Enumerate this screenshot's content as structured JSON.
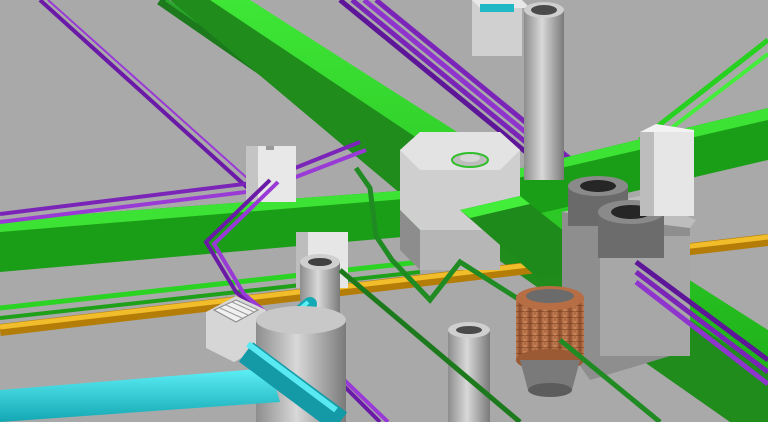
{
  "scene": {
    "kind": "3d-model-viewport",
    "colors": {
      "background": "#a9a9a9",
      "green_duct": "#22c71b",
      "green_duct_dark": "#1d7a1a",
      "dark_green_pipe": "#1f8b22",
      "purple_conduit": "#7a24b8",
      "yellow_pipe": "#e0a414",
      "cyan_pipe": "#1fc9d6",
      "equipment_light": "#d9d9d9",
      "equipment_mid": "#a6a6a6",
      "equipment_dark": "#6e6e6e",
      "brick": "#c27a4f"
    },
    "icons": [
      "pump-equipment",
      "junction-box",
      "vertical-pipe",
      "transformer-coil",
      "valve-housing"
    ]
  }
}
